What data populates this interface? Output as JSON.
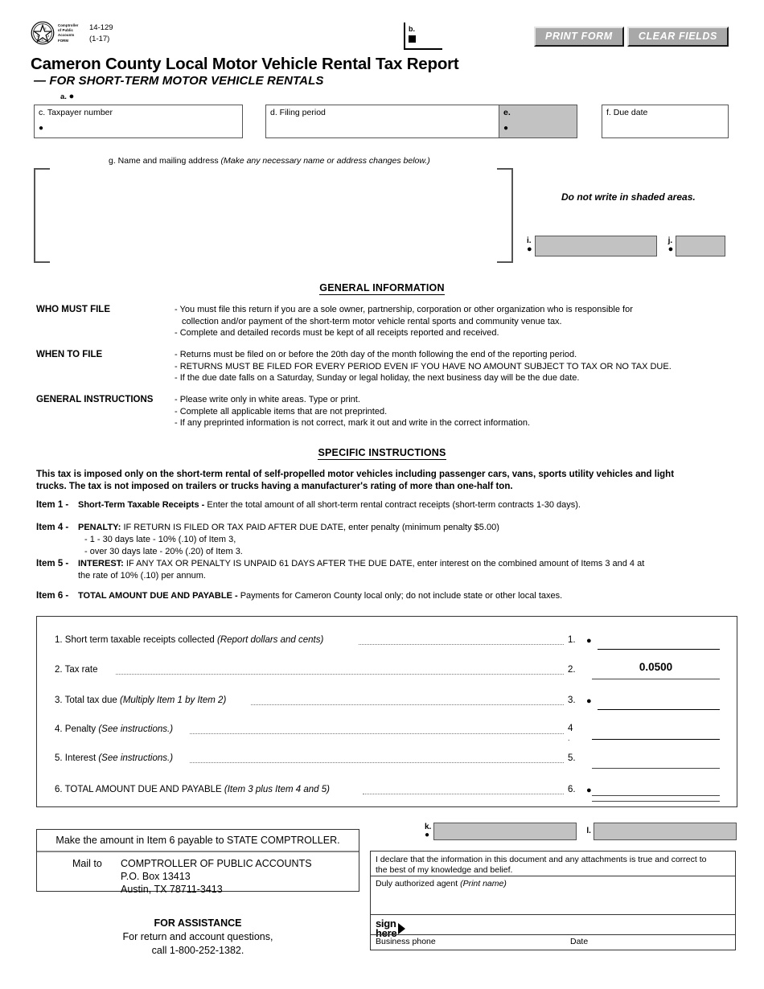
{
  "header": {
    "agency_lines": [
      "Comptroller",
      "of Public",
      "Accounts",
      "FORM"
    ],
    "form_number": "14-129",
    "form_revision": "(1-17)",
    "title": "Cameron County Local Motor Vehicle Rental Tax Report",
    "subtitle": "— FOR SHORT-TERM MOTOR VEHICLE RENTALS",
    "b_label": "b."
  },
  "buttons": {
    "print_form": "PRINT FORM",
    "clear_fields": "CLEAR FIELDS"
  },
  "fields": {
    "a_label": "a.",
    "taxpayer_number": {
      "label": "c. Taxpayer number",
      "value": ""
    },
    "filing_period": {
      "label": "d. Filing period",
      "value": ""
    },
    "e_label": "e.",
    "due_date": {
      "label": "f. Due date",
      "value": ""
    },
    "name_address_label": "g. Name and mailing address",
    "name_address_note": "(Make any necessary name or address changes below.)",
    "name_address_value": "",
    "do_not_write": "Do not write in shaded areas.",
    "i_label": "i.",
    "j_label": "j.",
    "k_label": "k.",
    "l_label": "l."
  },
  "general_information": {
    "heading": "GENERAL INFORMATION",
    "sections": [
      {
        "term": "WHO MUST FILE",
        "lines": [
          "- You must file this return if you are a sole owner, partnership, corporation or other organization who is responsible for",
          "collection and/or payment of the short-term motor vehicle rental sports and community venue tax.",
          "- Complete and detailed records must be kept of all receipts reported and received."
        ],
        "indent": [
          false,
          true,
          false
        ]
      },
      {
        "term": "WHEN TO FILE",
        "lines": [
          "- Returns must be filed on or before the 20th day of the month following the end of the reporting period.",
          "- RETURNS MUST BE FILED FOR EVERY PERIOD EVEN IF YOU HAVE NO AMOUNT SUBJECT TO TAX OR NO TAX DUE.",
          "- If the due date falls on a Saturday, Sunday or legal holiday, the next business day will be the due date."
        ],
        "indent": [
          false,
          false,
          false
        ]
      },
      {
        "term": "GENERAL INSTRUCTIONS",
        "lines": [
          "- Please write only in white areas. Type or print.",
          "- Complete all applicable items that are not preprinted.",
          "- If any preprinted information is not correct, mark it out and write in the correct information."
        ],
        "indent": [
          false,
          false,
          false
        ]
      }
    ]
  },
  "specific_instructions": {
    "heading": "SPECIFIC INSTRUCTIONS",
    "intro_line1": "This tax is imposed only on the short-term rental of self-propelled motor vehicles including passenger cars, vans, sports utility vehicles and light",
    "intro_line2": "trucks. The tax is not imposed on trailers or trucks having a manufacturer's rating of more than one-half ton.",
    "items": [
      {
        "num": "Item 1 -",
        "lead": "Short-Term Taxable Receipts - ",
        "text": "Enter the total amount of all short-term rental contract receipts (short-term contracts 1-30 days).",
        "subs": []
      },
      {
        "num": "Item 4 -",
        "lead": "PENALTY: ",
        "text": "IF RETURN IS FILED OR TAX PAID AFTER DUE DATE, enter penalty (minimum penalty $5.00)",
        "subs": [
          "- 1 - 30 days late - 10% (.10) of Item 3,",
          "- over 30 days late - 20% (.20) of Item 3."
        ]
      },
      {
        "num": "Item 5 -",
        "lead": "INTEREST: ",
        "text": "IF ANY TAX OR PENALTY IS UNPAID 61 DAYS AFTER THE DUE DATE, enter interest on the combined amount of Items 3 and 4 at",
        "text2": "the rate of 10% (.10) per annum.",
        "subs": []
      },
      {
        "num": "Item 6 -",
        "lead": "TOTAL AMOUNT DUE AND PAYABLE - ",
        "text": "Payments for Cameron County local only; do not include state or other local taxes.",
        "subs": []
      }
    ]
  },
  "computation": {
    "rows": [
      {
        "n": "1.",
        "desc": "1. Short term taxable receipts collected ",
        "italic": "(Report dollars and cents)",
        "value": "",
        "bullet": true
      },
      {
        "n": "2.",
        "desc": "2. Tax rate",
        "italic": "",
        "value": "0.0500",
        "bullet": false
      },
      {
        "n": "3.",
        "desc": "3. Total tax due ",
        "italic": "(Multiply Item 1 by Item 2)",
        "value": "",
        "bullet": true
      },
      {
        "n": "4",
        "desc": "4. Penalty ",
        "italic": "(See instructions.)",
        "value": "",
        "bullet": false
      },
      {
        "n": "5.",
        "desc": "5. Interest ",
        "italic": "(See instructions.)",
        "value": "",
        "bullet": false
      },
      {
        "n": "6.",
        "desc": "6. TOTAL AMOUNT DUE AND PAYABLE ",
        "italic": "(Item 3 plus Item 4 and 5)",
        "value": "",
        "bullet": true
      }
    ],
    "stray_period": "."
  },
  "payment": {
    "payable_to": "Make the amount in Item 6 payable to STATE COMPTROLLER.",
    "mail_to_label": "Mail to",
    "address_lines": [
      "COMPTROLLER OF PUBLIC ACCOUNTS",
      "P.O. Box 13413",
      "Austin, TX  78711-3413"
    ]
  },
  "assistance": {
    "heading": "FOR ASSISTANCE",
    "line1": "For return and account questions,",
    "line2": "call 1-800-252-1382."
  },
  "signature": {
    "declaration_line1": "I declare that the information in this document and any attachments is true and correct to",
    "declaration_line2": "the best of my knowledge and belief.",
    "agent_label": "Duly authorized agent ",
    "agent_note": "(Print name)",
    "sign_word1": "sign",
    "sign_word2": "here",
    "business_phone_label": "Business phone",
    "date_label": "Date"
  },
  "colors": {
    "shaded": "#c2c2c2",
    "button_face": "#a8a8a8",
    "rule": "#333333"
  }
}
